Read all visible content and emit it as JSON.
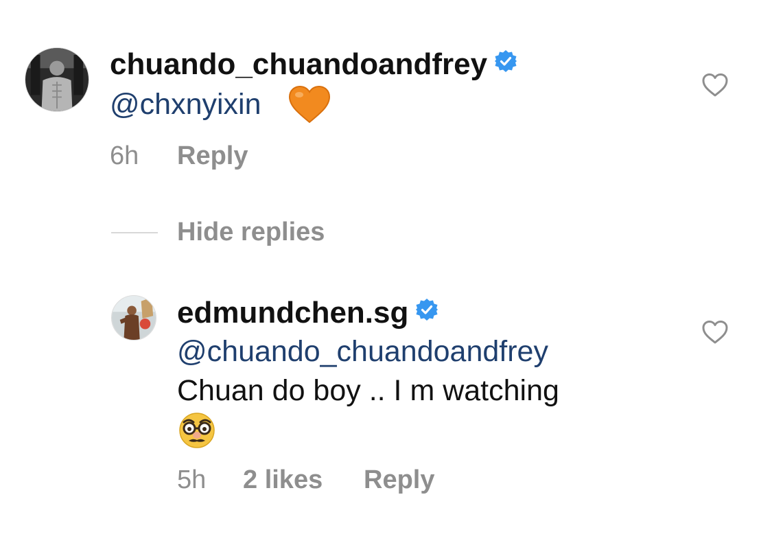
{
  "comment": {
    "username": "chuando_chuandoandfrey",
    "verified": true,
    "mention": "@chxnyixin",
    "emoji": "orange-heart",
    "time": "6h",
    "reply_label": "Reply",
    "like_icon": "heart-outline-icon"
  },
  "toggle_replies": {
    "label": "Hide replies"
  },
  "reply": {
    "username": "edmundchen.sg",
    "verified": true,
    "mention": "@chuando_chuandoandfrey",
    "text": "Chuan do boy .. I m watching",
    "emoji": "disguised-face",
    "time": "5h",
    "likes": "2 likes",
    "reply_label": "Reply",
    "like_icon": "heart-outline-icon"
  },
  "colors": {
    "mention": "#1f3f6e",
    "meta": "#8e8e8e",
    "verified": "#3797f0",
    "heart_emoji": "#f28a1f"
  }
}
